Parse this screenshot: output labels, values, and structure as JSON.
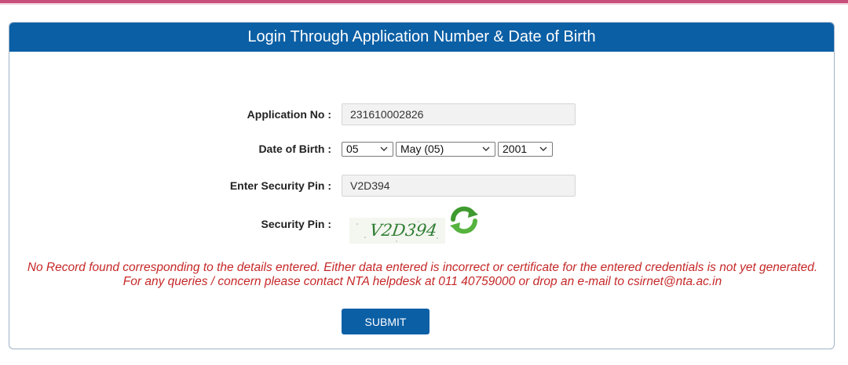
{
  "header": {
    "title": "Login Through Application Number & Date of Birth"
  },
  "form": {
    "application_no": {
      "label": "Application No :",
      "value": "231610002826"
    },
    "dob": {
      "label": "Date of Birth :",
      "day": "05",
      "month": "May (05)",
      "year": "2001"
    },
    "security_pin_input": {
      "label": "Enter Security Pin :",
      "value": "V2D394"
    },
    "security_pin_captcha": {
      "label": "Security Pin :",
      "captcha_text": "V2D394",
      "refresh_icon": "refresh-icon"
    }
  },
  "error_message": "No Record found corresponding to the details entered. Either data entered is incorrect or certificate for the entered credentials is not yet generated. For any queries / concern please contact NTA helpdesk at 011 40759000 or drop an e-mail to csirnet@nta.ac.in",
  "submit_label": "SUBMIT",
  "colors": {
    "header": "#0b5fa5",
    "error": "#c62828",
    "top_bar": "#c8507a",
    "captcha": "#2e7d32"
  }
}
